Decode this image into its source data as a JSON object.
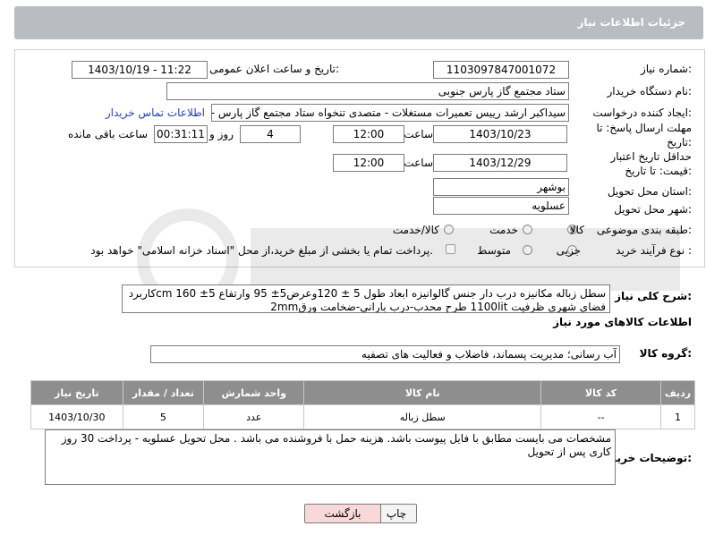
{
  "header": {
    "title": "جزئیات اطلاعات نیاز"
  },
  "labels": {
    "need_number": "شماره نیاز:",
    "announce_datetime": "تاریخ و ساعت اعلان عمومی:",
    "buyer_org": "نام دستگاه خریدار:",
    "requester": "ایجاد کننده درخواست:",
    "reply_deadline": "مهلت ارسال پاسخ: تا تاریخ:",
    "time": "ساعت",
    "days_and": "روز و",
    "remaining": "ساعت باقی مانده",
    "price_validity": "حداقل تاریخ اعتبار قیمت: تا تاریخ:",
    "province": "استان محل تحویل:",
    "city": "شهر محل تحویل:",
    "category": "طبقه بندی موضوعی:",
    "process_type": "نوع فرآیند خرید :",
    "general_desc": "شرح کلی نیاز:",
    "goods_info": "اطلاعات کالاهای مورد نیاز",
    "goods_group": "گروه کالا:",
    "buyer_notes": "توضیحات خریدار:"
  },
  "values": {
    "need_number": "1103097847001072",
    "announce_datetime": "1403/10/19 - 11:22",
    "buyer_org": "ستاد مجتمع گاز پارس جنوبی",
    "requester": "سیداکبر ارشد رییس تعمیرات مستغلات - متصدی تنخواه ستاد مجتمع گاز پارس -",
    "contact_link": "اطلاعات تماس خریدار",
    "reply_date": "1403/10/23",
    "reply_time": "12:00",
    "days": "4",
    "remaining_time": "00:31:11",
    "validity_date": "1403/12/29",
    "validity_time": "12:00",
    "province": "بوشهر",
    "city": "عسلویه",
    "general_desc": "سطل زباله مکانیزه درب دار جنس گالوانیزه ابعاد طول 5 ± 120وعرض5± 95 وارتفاع 5± 160 cmکاربرد فضای شهری ظرفیت 1100lit طرح محدب-درب بارانی-ضخامت ورق2mm",
    "goods_group": "آب رسانی؛ مدیریت پسماند، فاضلاب و فعالیت های تصفیه",
    "buyer_notes": "مشخصات می بایست مطابق با فایل پیوست باشد. هزینه حمل با فروشنده می باشد . محل تحویل عسلویه  - پرداخت 30 روز کاری پس از تحویل"
  },
  "category_options": [
    {
      "label": "کالا",
      "selected": true
    },
    {
      "label": "خدمت",
      "selected": false
    },
    {
      "label": "کالا/خدمت",
      "selected": false
    }
  ],
  "process_options": [
    {
      "label": "جزیی",
      "selected": false
    },
    {
      "label": "متوسط",
      "selected": false
    }
  ],
  "payment_note": "پرداخت تمام یا بخشی از مبلغ خرید،از محل \"اسناد خزانه اسلامی\" خواهد بود.",
  "table": {
    "headers": [
      "ردیف",
      "کد کالا",
      "نام کالا",
      "واحد شمارش",
      "تعداد / مقدار",
      "تاریخ نیاز"
    ],
    "rows": [
      [
        "1",
        "--",
        "سطل زباله",
        "عدد",
        "5",
        "1403/10/30"
      ]
    ]
  },
  "buttons": {
    "print": "چاپ",
    "back": "بازگشت"
  },
  "colors": {
    "header_bg": "#b9bcc0",
    "table_header_bg": "#8e8e8e",
    "link": "#1f3fbf",
    "back_button_bg": "#f8d8d8"
  }
}
